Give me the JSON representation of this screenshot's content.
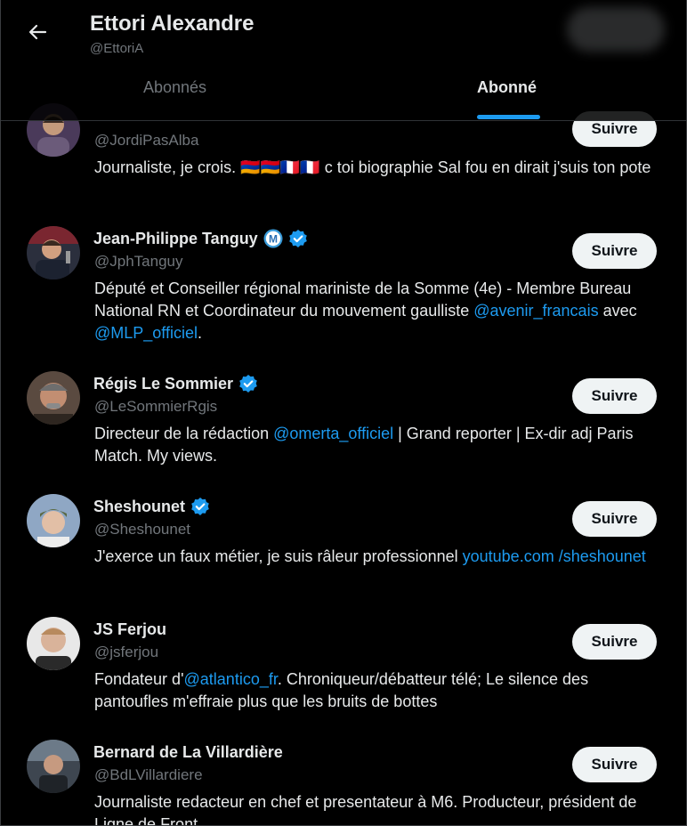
{
  "header": {
    "title": "Ettori Alexandre",
    "handle": "@EttoriA",
    "tabs": [
      {
        "label": "Abonnés",
        "active": false
      },
      {
        "label": "Abonné",
        "active": true
      }
    ]
  },
  "colors": {
    "accent": "#1d9bf0",
    "text": "#e7e9ea",
    "muted": "#71767b",
    "background": "#000000"
  },
  "users": [
    {
      "name": "",
      "handle": "@JordiPasAlba",
      "verified": true,
      "follow_label": "Suivre",
      "bio": [
        {
          "text": "Journaliste, je crois. 🇦🇲🇦🇲🇫🇷🇫🇷 c toi biographie Sal fou en dirait j'suis ton pote"
        }
      ]
    },
    {
      "name": "Jean-Philippe Tanguy",
      "handle": "@JphTanguy",
      "verified": true,
      "extra_badge": "M",
      "follow_label": "Suivre",
      "bio": [
        {
          "text": "Député et Conseiller régional mariniste de la Somme (4e) - Membre Bureau National RN et Coordinateur du mouvement gaulliste "
        },
        {
          "text": "@avenir_francais",
          "link": true
        },
        {
          "text": " avec "
        },
        {
          "text": "@MLP_officiel",
          "link": true
        },
        {
          "text": "."
        }
      ]
    },
    {
      "name": "Régis Le Sommier",
      "handle": "@LeSommierRgis",
      "verified": true,
      "follow_label": "Suivre",
      "bio": [
        {
          "text": "Directeur de la rédaction "
        },
        {
          "text": "@omerta_officiel",
          "link": true
        },
        {
          "text": " | Grand reporter | Ex-dir adj Paris Match. My views."
        }
      ]
    },
    {
      "name": "Sheshounet",
      "handle": "@Sheshounet",
      "verified": true,
      "follow_label": "Suivre",
      "bio": [
        {
          "text": "J'exerce un faux métier, je suis râleur professionnel "
        },
        {
          "text": "youtube.com /sheshounet",
          "link": true
        }
      ]
    },
    {
      "name": "JS Ferjou",
      "handle": "@jsferjou",
      "verified": false,
      "follow_label": "Suivre",
      "bio": [
        {
          "text": "Fondateur d'"
        },
        {
          "text": "@atlantico_fr",
          "link": true
        },
        {
          "text": ". Chroniqueur/débatteur télé; Le silence des pantoufles m'effraie plus que les bruits de bottes"
        }
      ]
    },
    {
      "name": "Bernard de La Villardière",
      "handle": "@BdLVillardiere",
      "verified": false,
      "follow_label": "Suivre",
      "bio": [
        {
          "text": "Journaliste redacteur en chef et presentateur à M6. Producteur, président de Ligne de Front"
        }
      ]
    }
  ]
}
